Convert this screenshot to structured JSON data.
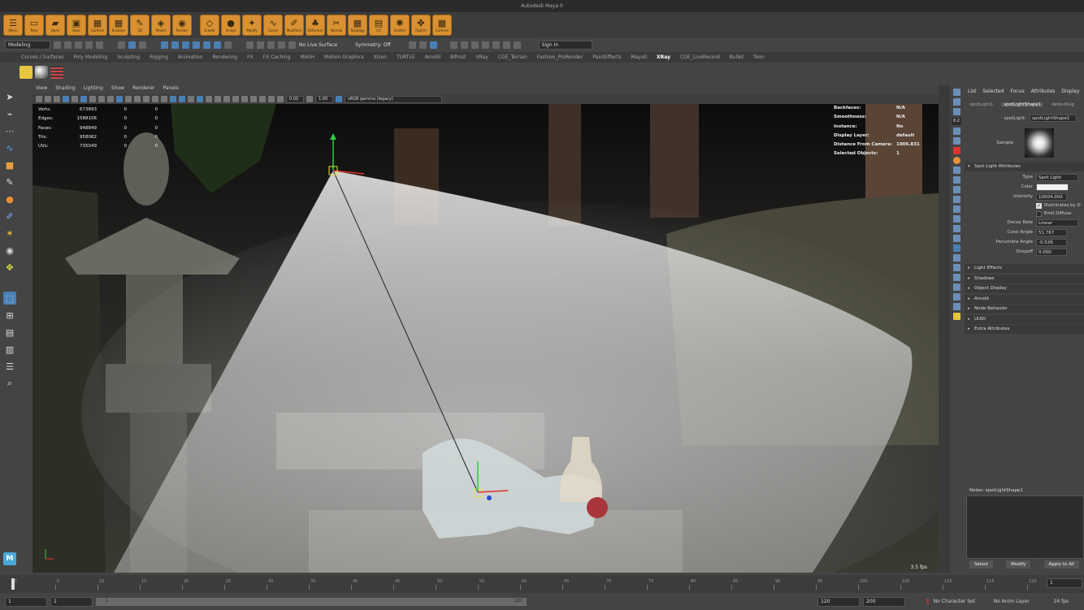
{
  "window_title": "Autodesk Maya 0",
  "shelf_top": [
    {
      "label": "Menu",
      "icon": "menu-icon"
    },
    {
      "label": "New",
      "icon": "new-file-icon"
    },
    {
      "label": "Open",
      "icon": "open-folder-icon"
    },
    {
      "label": "Save",
      "icon": "save-icon"
    },
    {
      "label": "Content",
      "icon": "grid-icon"
    },
    {
      "label": "Browser",
      "icon": "grid-icon"
    },
    {
      "label": "3D",
      "icon": "paint-icon"
    },
    {
      "label": "Model",
      "icon": "cube-icon"
    },
    {
      "label": "Render",
      "icon": "render-icon"
    },
    {
      "label": "Create",
      "icon": "create-icon"
    },
    {
      "label": "Sculpt",
      "icon": "sculpt-icon"
    },
    {
      "label": "Modify",
      "icon": "modify-icon"
    },
    {
      "label": "Curve",
      "icon": "curve-icon"
    },
    {
      "label": "Modifiers",
      "icon": "pencil-icon"
    },
    {
      "label": "Deformer",
      "icon": "bell-icon"
    },
    {
      "label": "Normal",
      "icon": "brush-icon"
    },
    {
      "label": "Topology",
      "icon": "grid-icon"
    },
    {
      "label": "UV",
      "icon": "uv-icon"
    },
    {
      "label": "Scatter",
      "icon": "particles-icon"
    },
    {
      "label": "RigCtrl",
      "icon": "rig-icon"
    },
    {
      "label": "Camera",
      "icon": "camera-grid-icon"
    }
  ],
  "status_line": {
    "mode_dropdown": "Modeling",
    "live_surface": "No Live Surface",
    "symmetry": "Symmetry: Off",
    "sign_in": "Sign In"
  },
  "shelf_tabs": [
    "Curves / Surfaces",
    "Poly Modeling",
    "Sculpting",
    "Rigging",
    "Animation",
    "Rendering",
    "FX",
    "FX Caching",
    "MASH",
    "Motion Graphics",
    "XGen",
    "TURTLE",
    "Arnold",
    "Bifrost",
    "VRay",
    "CGE_Terrain",
    "Fashion_ProRender",
    "PaintEffects",
    "Mayall",
    "XRay",
    "CGE_LiveRecord",
    "Bullet",
    "Toon"
  ],
  "active_shelf_tab": "XRay",
  "viewport_menu": [
    "View",
    "Shading",
    "Lighting",
    "Show",
    "Renderer",
    "Panels"
  ],
  "viewport_toolbar": {
    "exposure": "0.00",
    "gamma": "1.00",
    "color_space": "sRGB gamma (legacy)"
  },
  "hud_left": [
    {
      "label": "Verts:",
      "v1": "673893",
      "v2": "0",
      "v3": "0"
    },
    {
      "label": "Edges:",
      "v1": "1588106",
      "v2": "0",
      "v3": "0"
    },
    {
      "label": "Faces:",
      "v1": "948849",
      "v2": "0",
      "v3": "0"
    },
    {
      "label": "Tris:",
      "v1": "958062",
      "v2": "0",
      "v3": "0"
    },
    {
      "label": "UVs:",
      "v1": "735049",
      "v2": "0",
      "v3": "0"
    }
  ],
  "hud_right": [
    {
      "label": "Backfaces:",
      "value": "N/A"
    },
    {
      "label": "Smoothness:",
      "value": "N/A"
    },
    {
      "label": "Instance:",
      "value": "No"
    },
    {
      "label": "Display Layer:",
      "value": "default"
    },
    {
      "label": "Distance From Camera:",
      "value": "1006.831"
    },
    {
      "label": "Selected Objects:",
      "value": "1"
    }
  ],
  "fps": "3.5 fps",
  "attribute_editor": {
    "menu": [
      "List",
      "Selected",
      "Focus",
      "Attributes",
      "Display"
    ],
    "tabs": [
      "spotLight1",
      "spotLightShape1",
      "defaultLig"
    ],
    "active_tab": "spotLightShape1",
    "node_label": "spotLight:",
    "node_value": "spotLightShape1",
    "sample_label": "Sample",
    "sample_value": "0.2",
    "section_open": "Spot Light Attributes",
    "type_label": "Type",
    "type_value": "Spot Light",
    "color_label": "Color",
    "intensity_label": "Intensity",
    "intensity_value": "10004.000",
    "illuminates_label": "Illuminates by D",
    "emit_diffuse_label": "Emit Diffuse",
    "decay_label": "Decay Rate",
    "decay_value": "Linear",
    "cone_label": "Cone Angle",
    "cone_value": "51.767",
    "penumbra_label": "Penumbra Angle",
    "penumbra_value": "-0.526",
    "dropoff_label": "Dropoff",
    "dropoff_value": "0.000",
    "sections": [
      "Light Effects",
      "Shadows",
      "Object Display",
      "Arnold",
      "Node Behavior",
      "UUID",
      "Extra Attributes"
    ],
    "notes_label": "Notes: spotLightShape1",
    "buttons": [
      "Select",
      "Modify",
      "Apply to All"
    ]
  },
  "timeline": {
    "ticks": [
      "1",
      "5",
      "10",
      "15",
      "20",
      "25",
      "30",
      "35",
      "40",
      "45",
      "50",
      "55",
      "60",
      "65",
      "70",
      "75",
      "80",
      "85",
      "90",
      "95",
      "100",
      "105",
      "110",
      "115",
      "120"
    ],
    "current_frame": "1"
  },
  "range_bar": {
    "start": "1",
    "anim_start": "1",
    "slider_left": "1",
    "slider_right": "120",
    "end": "120",
    "anim_end": "200",
    "character_set": "No Character Set",
    "anim_layer": "No Anim Layer",
    "fps": "24 fps"
  },
  "colors": {
    "shelf_button": "#d99131",
    "selection_blue": "#4a7fb3",
    "ui_bg": "#444444"
  }
}
